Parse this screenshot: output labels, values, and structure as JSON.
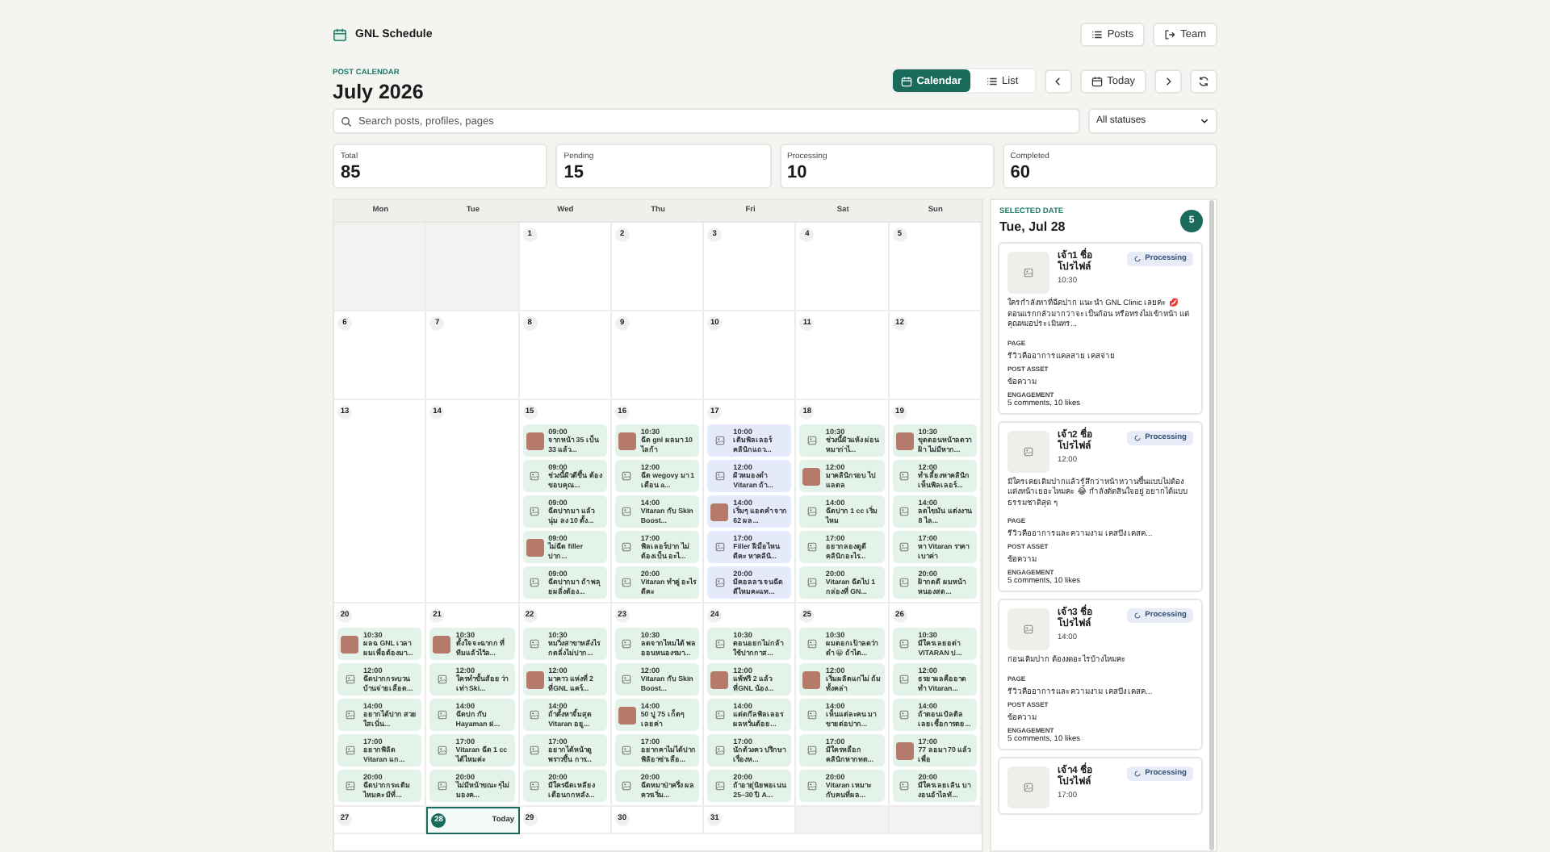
{
  "app": {
    "title": "GNL Schedule"
  },
  "nav": [
    {
      "label": "Posts",
      "kind": "list"
    },
    {
      "label": "Team",
      "kind": "exit"
    }
  ],
  "header": {
    "eyebrow": "POST CALENDAR",
    "title": "July 2026"
  },
  "view_toggle": [
    {
      "label": "Calendar",
      "kind": "calendar",
      "selected": true
    },
    {
      "label": "List",
      "kind": "list",
      "selected": false
    }
  ],
  "today_button": "Today",
  "search": {
    "placeholder": "Search posts, profiles, pages"
  },
  "status_filter": {
    "value": "All statuses"
  },
  "stats": [
    {
      "label": "Total",
      "value": "85"
    },
    {
      "label": "Pending",
      "value": "15"
    },
    {
      "label": "Processing",
      "value": "10"
    },
    {
      "label": "Completed",
      "value": "60"
    }
  ],
  "calendar": {
    "weekdays": [
      "Mon",
      "Tue",
      "Wed",
      "Thu",
      "Fri",
      "Sat",
      "Sun"
    ],
    "weeks": [
      [
        {
          "kind": "blank"
        },
        {
          "kind": "blank"
        },
        {
          "kind": "day",
          "day": "1",
          "today": false,
          "selected": false
        },
        {
          "kind": "day",
          "day": "2",
          "today": false,
          "selected": false
        },
        {
          "kind": "day",
          "day": "3",
          "today": false,
          "selected": false
        },
        {
          "kind": "day",
          "day": "4",
          "today": false,
          "selected": false
        },
        {
          "kind": "day",
          "day": "5",
          "today": false,
          "selected": false
        }
      ],
      [
        {
          "kind": "day",
          "day": "6",
          "today": false,
          "selected": false
        },
        {
          "kind": "day",
          "day": "7",
          "today": false,
          "selected": false
        },
        {
          "kind": "day",
          "day": "8",
          "today": false,
          "selected": false
        },
        {
          "kind": "day",
          "day": "9",
          "today": false,
          "selected": false
        },
        {
          "kind": "day",
          "day": "10",
          "today": false,
          "selected": false
        },
        {
          "kind": "day",
          "day": "11",
          "today": false,
          "selected": false
        },
        {
          "kind": "day",
          "day": "12",
          "today": false,
          "selected": false
        }
      ],
      [
        {
          "kind": "day",
          "day": "13",
          "today": false,
          "selected": false
        },
        {
          "kind": "day",
          "day": "14",
          "today": false,
          "selected": false
        },
        {
          "kind": "day",
          "day": "15",
          "today": false,
          "selected": false,
          "events": [
            {
              "time": "09:00",
              "text": "จากหน้า 35 เป็น 33 แล้ว...",
              "kind": "photo",
              "color": "#e3f3e9"
            },
            {
              "time": "09:00",
              "text": "ช่วงนี้ผิวดีขึ้น ต้องขอบคุณ...",
              "kind": "placeholder",
              "color": "#e3f3e9"
            },
            {
              "time": "09:00",
              "text": "ฉีดปากมา แล้ว นุ่ม ลง 10 ตั้ง...",
              "kind": "placeholder",
              "color": "#e3f3e9"
            },
            {
              "time": "09:00",
              "text": "ไม่ฉีด filler ปาก...",
              "kind": "photo",
              "color": "#e3f3e9"
            },
            {
              "time": "09:00",
              "text": "ฉีดปากมา ถ้า พลุยผลิ่งต้อง...",
              "kind": "placeholder",
              "color": "#e3f3e9"
            }
          ]
        },
        {
          "kind": "day",
          "day": "16",
          "today": false,
          "selected": false,
          "events": [
            {
              "time": "10:30",
              "text": "ฉีด gnl ผลมา 10 ไลก้า",
              "kind": "photo",
              "color": "#e3f3e9"
            },
            {
              "time": "12:00",
              "text": "ฉีด wegovy มา 1 เดือน a...",
              "kind": "placeholder",
              "color": "#e3f3e9"
            },
            {
              "time": "14:00",
              "text": "Vitaran กับ Skin Boost...",
              "kind": "placeholder",
              "color": "#e3f3e9"
            },
            {
              "time": "17:00",
              "text": "ฟิลเลอร์ปาก ไม่ ต้องเป็น อะไ...",
              "kind": "placeholder",
              "color": "#e3f3e9"
            },
            {
              "time": "20:00",
              "text": "Vitaran ทำคู่ อะไรดีคะ",
              "kind": "placeholder",
              "color": "#e3f3e9"
            }
          ]
        },
        {
          "kind": "day",
          "day": "17",
          "today": false,
          "selected": false,
          "events": [
            {
              "time": "10:00",
              "text": "เติมฟิลเลอร์ คลินิกแถว...",
              "kind": "placeholder",
              "color": "#e4eaf9"
            },
            {
              "time": "12:00",
              "text": "ผิวหมองดำ Vitaran ถ้า...",
              "kind": "placeholder",
              "color": "#e4eaf9"
            },
            {
              "time": "14:00",
              "text": "เริ่มๆ แอดคำ จาก 62 ผล...",
              "kind": "photo",
              "color": "#e4eaf9"
            },
            {
              "time": "17:00",
              "text": "Filler ฝีมือไหน ดีคะ หาคลินิ...",
              "kind": "placeholder",
              "color": "#e4eaf9"
            },
            {
              "time": "20:00",
              "text": "มีคอลลาเจนฉีด ดีไหมคะแท...",
              "kind": "placeholder",
              "color": "#e4eaf9"
            }
          ]
        },
        {
          "kind": "day",
          "day": "18",
          "today": false,
          "selected": false,
          "events": [
            {
              "time": "10:30",
              "text": "ช่วงนี้ผิวแห้ง ผ่อนหมาก่าไ...",
              "kind": "placeholder",
              "color": "#e3f3e9"
            },
            {
              "time": "12:00",
              "text": "มาคลินิกรอบ ไปแลดล",
              "kind": "photo",
              "color": "#e3f3e9"
            },
            {
              "time": "14:00",
              "text": "ฉีดปาก 1 cc เริ่มไหม",
              "kind": "placeholder",
              "color": "#e3f3e9"
            },
            {
              "time": "17:00",
              "text": "อยากลองดูดี คลินิกอะไร...",
              "kind": "placeholder",
              "color": "#e3f3e9"
            },
            {
              "time": "20:00",
              "text": "Vitaran ฉีดไป 1 กล่องที่ GN...",
              "kind": "placeholder",
              "color": "#e3f3e9"
            }
          ]
        },
        {
          "kind": "day",
          "day": "19",
          "today": false,
          "selected": false,
          "events": [
            {
              "time": "10:30",
              "text": "ขุดดอนหน้าลดวา ฝ้า ไม่มีหาก...",
              "kind": "photo",
              "color": "#e3f3e9"
            },
            {
              "time": "12:00",
              "text": "ทำเลี้ยงหาคลินิก เห็นฟิลเลอร์...",
              "kind": "placeholder",
              "color": "#e3f3e9"
            },
            {
              "time": "14:00",
              "text": "ลดไขมัน แต่งงาน 8 ไล...",
              "kind": "placeholder",
              "color": "#e3f3e9"
            },
            {
              "time": "17:00",
              "text": "หา Vitaran ราคาเบาค่า",
              "kind": "placeholder",
              "color": "#e3f3e9"
            },
            {
              "time": "20:00",
              "text": "ฝ้ากดดี ผมหน้าหนองสด...",
              "kind": "placeholder",
              "color": "#e3f3e9"
            }
          ]
        }
      ],
      [
        {
          "kind": "day",
          "day": "20",
          "today": false,
          "selected": false,
          "events": [
            {
              "time": "10:30",
              "text": "ผลฉ GNL เวลา ผมเพื่อต้องมา...",
              "kind": "photo",
              "color": "#e3f3e9"
            },
            {
              "time": "12:00",
              "text": "ฉีดปากกระบวน บ้านจ่ายเลือด...",
              "kind": "placeholder",
              "color": "#e3f3e9"
            },
            {
              "time": "14:00",
              "text": "อยากได้ปาก สวย ใสเนิ่น...",
              "kind": "placeholder",
              "color": "#e3f3e9"
            },
            {
              "time": "17:00",
              "text": "อยากฟิลิด Vitaran แก...",
              "kind": "placeholder",
              "color": "#e3f3e9"
            },
            {
              "time": "20:00",
              "text": "ฉีดปากกระเติม ไหมคะ มีที่...",
              "kind": "placeholder",
              "color": "#e3f3e9"
            }
          ]
        },
        {
          "kind": "day",
          "day": "21",
          "today": false,
          "selected": false,
          "events": [
            {
              "time": "10:30",
              "text": "ตั้งใจจะฉากก ที่ทีมแล้วไวัล...",
              "kind": "photo",
              "color": "#e3f3e9"
            },
            {
              "time": "12:00",
              "text": "ใครทำขั้นส้อย ว่าเท่า Ski...",
              "kind": "placeholder",
              "color": "#e3f3e9"
            },
            {
              "time": "14:00",
              "text": "ฉีดปก กับ Hayaman ฝ...",
              "kind": "placeholder",
              "color": "#e3f3e9"
            },
            {
              "time": "17:00",
              "text": "Vitaran ฉีด 1 cc ได้ไหมค่ะ",
              "kind": "placeholder",
              "color": "#e3f3e9"
            },
            {
              "time": "20:00",
              "text": "ไม่มีหน้าขณะ ๆไม่มองค...",
              "kind": "placeholder",
              "color": "#e3f3e9"
            }
          ]
        },
        {
          "kind": "day",
          "day": "22",
          "today": false,
          "selected": false,
          "events": [
            {
              "time": "10:30",
              "text": "หมวิ่งสาขาหลังไร กดลิ่งไม่ปาก...",
              "kind": "placeholder",
              "color": "#e3f3e9"
            },
            {
              "time": "12:00",
              "text": "มาคาว แห่งที่ 2 ที่GNL แคร์...",
              "kind": "photo",
              "color": "#e3f3e9"
            },
            {
              "time": "14:00",
              "text": "ถ้าตั้งหาจิ้มสุด Vitaran อยู...",
              "kind": "placeholder",
              "color": "#e3f3e9"
            },
            {
              "time": "17:00",
              "text": "อยากได้หน้าดู พราวขึ้น การ...",
              "kind": "placeholder",
              "color": "#e3f3e9"
            },
            {
              "time": "20:00",
              "text": "มีใครฉีดเหลียง เดือนกกหลัง...",
              "kind": "placeholder",
              "color": "#e3f3e9"
            }
          ]
        },
        {
          "kind": "day",
          "day": "23",
          "today": false,
          "selected": false,
          "events": [
            {
              "time": "10:30",
              "text": "ลดจากไหมได้ พลออนหนองรมา...",
              "kind": "placeholder",
              "color": "#e3f3e9"
            },
            {
              "time": "12:00",
              "text": "Vitaran กับ Skin Boost...",
              "kind": "placeholder",
              "color": "#e3f3e9"
            },
            {
              "time": "14:00",
              "text": "50 ปู 75 เก็ตๆ เลยค่า",
              "kind": "photo",
              "color": "#e3f3e9"
            },
            {
              "time": "17:00",
              "text": "อยากคาไม่ได้ปาก ฟิลิอาซ่าเลือ...",
              "kind": "placeholder",
              "color": "#e3f3e9"
            },
            {
              "time": "20:00",
              "text": "ฉีดหมาป่าครึ่ง ผล ควรเริ่ม...",
              "kind": "placeholder",
              "color": "#e3f3e9"
            }
          ]
        },
        {
          "kind": "day",
          "day": "24",
          "today": false,
          "selected": false,
          "events": [
            {
              "time": "10:30",
              "text": "ตอนอยกไม่กล้า ใช้ปากกาส...",
              "kind": "placeholder",
              "color": "#e3f3e9"
            },
            {
              "time": "12:00",
              "text": "แพ้ฟรี 2 แล้ว ที่GNL น้อง...",
              "kind": "photo",
              "color": "#e3f3e9"
            },
            {
              "time": "14:00",
              "text": "แต่ดกีลฟิลเลอร ผลหวั่นต้อย...",
              "kind": "placeholder",
              "color": "#e3f3e9"
            },
            {
              "time": "17:00",
              "text": "นักต้วงคว ปรึกษาเรื่องห...",
              "kind": "placeholder",
              "color": "#e3f3e9"
            },
            {
              "time": "20:00",
              "text": "ถ้าอายุ่นิยพอเนน 25–30 ปี A...",
              "kind": "placeholder",
              "color": "#e3f3e9"
            }
          ]
        },
        {
          "kind": "day",
          "day": "25",
          "today": false,
          "selected": false,
          "events": [
            {
              "time": "10:30",
              "text": "ผมตอกเป้าลดว่า ดำ 😀 ถ้าไต...",
              "kind": "placeholder",
              "color": "#e3f3e9"
            },
            {
              "time": "12:00",
              "text": "เริ่มผลิตแก่ไม่ ถ้มทั้งคล่า",
              "kind": "photo",
              "color": "#e3f3e9"
            },
            {
              "time": "14:00",
              "text": "เห็นแต่ละคน มาขายต่อปาก...",
              "kind": "placeholder",
              "color": "#e3f3e9"
            },
            {
              "time": "17:00",
              "text": "มีใครหลือก คลินิกหากทต...",
              "kind": "placeholder",
              "color": "#e3f3e9"
            },
            {
              "time": "20:00",
              "text": "Vitaran เหมาะ กับคนที่ผล...",
              "kind": "placeholder",
              "color": "#e3f3e9"
            }
          ]
        },
        {
          "kind": "day",
          "day": "26",
          "today": false,
          "selected": false,
          "events": [
            {
              "time": "10:30",
              "text": "มีใครเลยอต่า VITARAN ป...",
              "kind": "placeholder",
              "color": "#e3f3e9"
            },
            {
              "time": "12:00",
              "text": "ธรยาผลคืออาด ทำ Vitaran...",
              "kind": "placeholder",
              "color": "#e3f3e9"
            },
            {
              "time": "14:00",
              "text": "ถ้าตอนเบิลติล เลยเชื้อการตย...",
              "kind": "placeholder",
              "color": "#e3f3e9"
            },
            {
              "time": "17:00",
              "text": "77 ลอมา 70 แล้วเพื่อ",
              "kind": "photo",
              "color": "#e3f3e9"
            },
            {
              "time": "20:00",
              "text": "มีใครเลยเลิน บางอนอ้าไลทั...",
              "kind": "placeholder",
              "color": "#e3f3e9"
            }
          ]
        }
      ],
      [
        {
          "kind": "day",
          "day": "27",
          "today": false,
          "selected": false
        },
        {
          "kind": "day",
          "day": "28",
          "today": true,
          "selected": true,
          "badge": "Today"
        },
        {
          "kind": "day",
          "day": "29",
          "today": false,
          "selected": false
        },
        {
          "kind": "day",
          "day": "30",
          "today": false,
          "selected": false
        },
        {
          "kind": "day",
          "day": "31",
          "today": false,
          "selected": false
        },
        {
          "kind": "blank"
        },
        {
          "kind": "blank"
        }
      ]
    ]
  },
  "sidebar": {
    "eyebrow": "SELECTED DATE",
    "title": "Tue, Jul 28",
    "count": "5",
    "posts": [
      {
        "profile": "เจ้า1 ชื่อ โปรไฟล์",
        "time": "10:30",
        "status": "Processing",
        "text": "ใครกำลังหาที่ฉีดปาก แนะนำ GNL Clinic เลยค่ะ 💋 ตอนแรกกลัวมากว่าจะเป็นก้อน หรือทรงไม่เข้าหน้า แต่คุณหมอประเมินทร...",
        "fields": [
          {
            "label": "PAGE",
            "value": "รีวิวคืออาการแคลสาย เคสจ่าย"
          },
          {
            "label": "POST ASSET",
            "value": "ข้อความ"
          },
          {
            "label": "ENGAGEMENT",
            "value": "5 comments, 10 likes"
          }
        ]
      },
      {
        "profile": "เจ้า2 ชื่อ โปรไฟล์",
        "time": "12:00",
        "status": "Processing",
        "text": "มีใครเคยเติมปากแล้วรู้สึกว่าหน้าหวานขึ้นแบบไม่ต้องแต่งหน้าเยอะไหมคะ 😂 กำลังตัดสินใจอยู่ อยากได้แบบธรรมชาติสุด ๆ",
        "fields": [
          {
            "label": "PAGE",
            "value": "รีวิวคืออาการและความงาม เคสปิง เคสค..."
          },
          {
            "label": "POST ASSET",
            "value": "ข้อความ"
          },
          {
            "label": "ENGAGEMENT",
            "value": "5 comments, 10 likes"
          }
        ]
      },
      {
        "profile": "เจ้า3 ชื่อ โปรไฟล์",
        "time": "14:00",
        "status": "Processing",
        "text": "ก่อนเติมปาก ต้องงดอะไรบ้างไหมคะ",
        "fields": [
          {
            "label": "PAGE",
            "value": "รีวิวคืออาการและความงาม เคสปิง เคสค..."
          },
          {
            "label": "POST ASSET",
            "value": "ข้อความ"
          },
          {
            "label": "ENGAGEMENT",
            "value": "5 comments, 10 likes"
          }
        ]
      },
      {
        "profile": "เจ้า4 ชื่อ โปรไฟล์",
        "time": "17:00",
        "status": "Processing"
      }
    ]
  }
}
